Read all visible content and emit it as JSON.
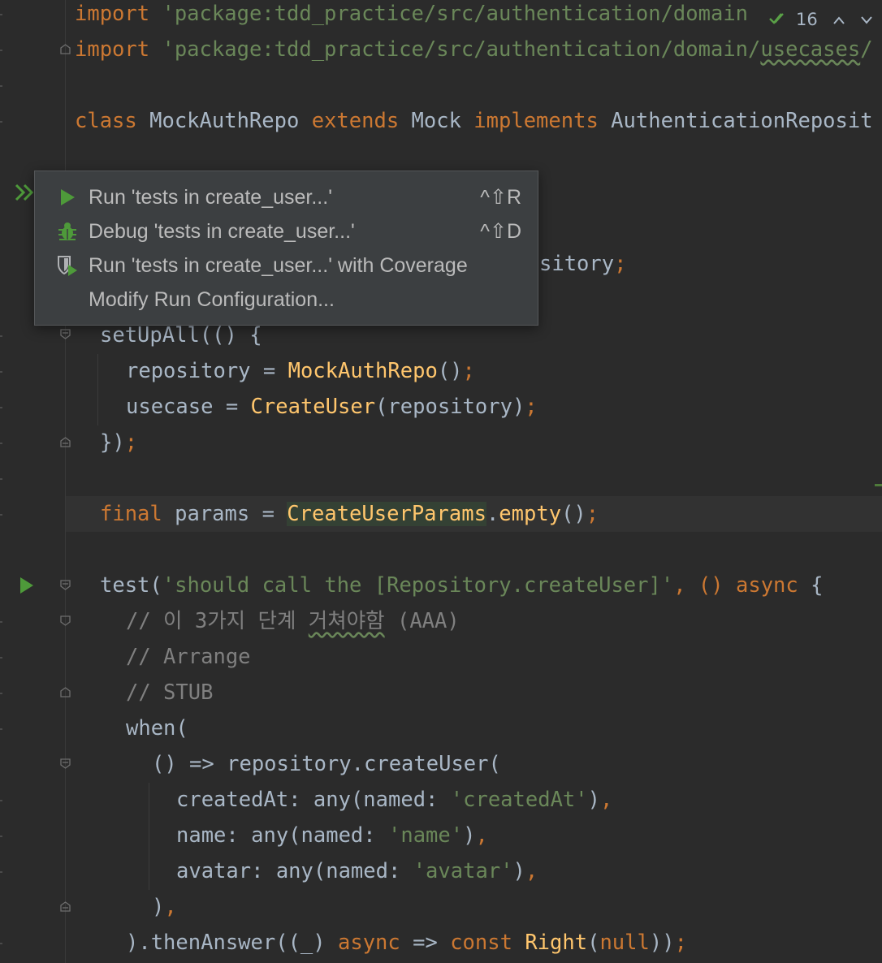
{
  "inspection": {
    "count": "16",
    "icon": "check-double-icon"
  },
  "popup": {
    "items": [
      {
        "label": "Run 'tests in create_user...'",
        "shortcut": "^⇧R",
        "icon": "run-icon"
      },
      {
        "label": "Debug 'tests in create_user...'",
        "shortcut": "^⇧D",
        "icon": "bug-icon"
      },
      {
        "label": "Run 'tests in create_user...' with Coverage",
        "shortcut": "",
        "icon": "coverage-icon"
      },
      {
        "label": "Modify Run Configuration...",
        "shortcut": "",
        "icon": ""
      }
    ]
  },
  "code": {
    "l1": {
      "kw": "import",
      "str": " 'package:tdd_practice/src/authentication/domain"
    },
    "l2": {
      "kw": "import",
      "str_a": " 'package:tdd_practice/src/authentication/domain/",
      "str_b": "usecases",
      "str_c": "/"
    },
    "l3": {
      "kw1": "class",
      "name": " MockAuthRepo ",
      "kw2": "extends",
      "mock": " Mock ",
      "kw3": "implements",
      "iface": " AuthenticationReposit"
    },
    "l4": {
      "tail": "sitory",
      "semi": ";"
    },
    "l5": {
      "a": "setUpAll(() {"
    },
    "l6": {
      "a": "repository = ",
      "fn": "MockAuthRepo",
      "b": "()",
      "semi": ";"
    },
    "l7": {
      "a": "usecase = ",
      "fn": "CreateUser",
      "b": "(repository)",
      "semi": ";"
    },
    "l8": {
      "a": "})",
      "semi": ";"
    },
    "l9": {
      "kw": "final",
      "a": " params = ",
      "fn": "CreateUserParams",
      "b": ".",
      "fn2": "empty",
      "c": "()",
      "semi": ";"
    },
    "l10": {
      "a": "test(",
      "str": "'should call the [Repository.createUser]'",
      "b": ", () ",
      "kw": "async",
      "c": " {"
    },
    "l11": {
      "a": "// 이 3가지 단계 ",
      "b": "거쳐야함",
      "c": " (AAA)"
    },
    "l12": {
      "a": "// Arrange"
    },
    "l13": {
      "a": "// STUB"
    },
    "l14": {
      "a": "when("
    },
    "l15": {
      "a": "() => repository.createUser("
    },
    "l16": {
      "a": "createdAt: any(named: ",
      "str": "'createdAt'",
      "b": ")",
      "comma": ","
    },
    "l17": {
      "a": "name: any(named: ",
      "str": "'name'",
      "b": ")",
      "comma": ","
    },
    "l18": {
      "a": "avatar: any(named: ",
      "str": "'avatar'",
      "b": ")",
      "comma": ","
    },
    "l19": {
      "a": ")",
      "comma": ","
    },
    "l20": {
      "a": ").thenAnswer((_) ",
      "kw": "async",
      "b": " => ",
      "kw2": "const",
      "c": " ",
      "fn": "Right",
      "d": "(",
      "kw3": "null",
      "e": "))",
      "semi": ";"
    }
  }
}
